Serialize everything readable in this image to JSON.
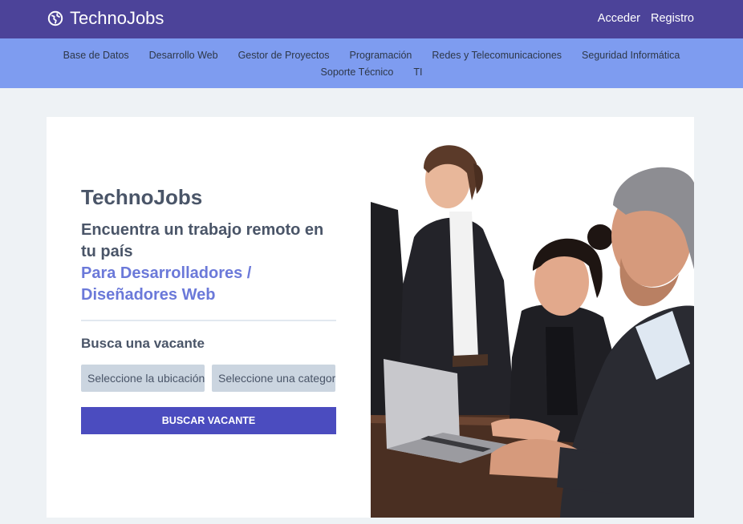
{
  "header": {
    "brand": "TechnoJobs",
    "auth": [
      "Acceder",
      "Registro"
    ]
  },
  "categories": [
    "Base de Datos",
    "Desarrollo Web",
    "Gestor de Proyectos",
    "Programación",
    "Redes y Telecomunicaciones",
    "Seguridad Informática",
    "Soporte Técnico",
    "TI"
  ],
  "hero": {
    "title_light": "Techno",
    "title_bold": "Jobs",
    "headline": "Encuentra un trabajo remoto en tu país",
    "headline_accent": "Para Desarrolladores / Diseñadores Web",
    "search_title": "Busca una vacante",
    "location_placeholder": "Seleccione la ubicación",
    "category_placeholder": "Seleccione una categoría",
    "button": "BUSCAR VACANTE"
  },
  "colors": {
    "topbar": "#4c4399",
    "catbar": "#7e9cf0",
    "accent": "#6b79d9",
    "button": "#4b4cbf"
  },
  "icons": {
    "brand": "globe-icon"
  }
}
